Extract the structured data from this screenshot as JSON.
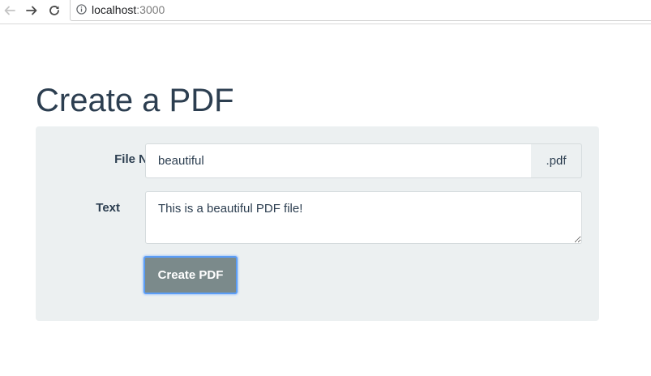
{
  "browser": {
    "url_host": "localhost",
    "url_port": ":3000",
    "back_icon": "arrow-left-icon",
    "forward_icon": "arrow-right-icon",
    "reload_icon": "reload-icon",
    "info_icon": "info-circle-icon"
  },
  "page": {
    "title": "Create a PDF"
  },
  "form": {
    "file_name_label": "File Name",
    "file_name_value": "beautiful",
    "file_extension": ".pdf",
    "text_label": "Text",
    "text_value": "This is a beautiful PDF file!",
    "submit_label": "Create PDF"
  },
  "colors": {
    "title": "#2c3e50",
    "panel_background": "#ecf0f1",
    "button_background": "#7b8a8b",
    "focus_ring": "#5b9df6"
  }
}
